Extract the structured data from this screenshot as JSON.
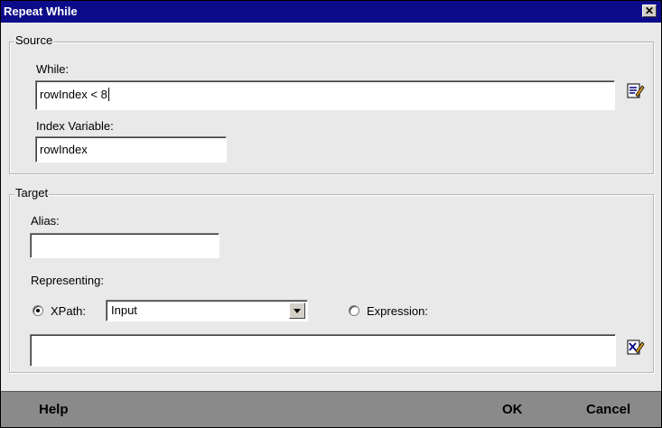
{
  "dialog": {
    "title": "Repeat While",
    "close_glyph": "✕"
  },
  "source": {
    "legend": "Source",
    "while_label": "While:",
    "while_value": "rowIndex < 8",
    "while_edit_icon": "edit-expression-icon",
    "index_label": "Index Variable:",
    "index_value": "rowIndex"
  },
  "target": {
    "legend": "Target",
    "alias_label": "Alias:",
    "alias_value": "",
    "representing_label": "Representing:",
    "xpath_label": "XPath:",
    "xpath_selected": "Input",
    "expression_label": "Expression:",
    "expression_value": "",
    "expression_edit_icon": "edit-xpath-icon"
  },
  "footer": {
    "help": "Help",
    "ok": "OK",
    "cancel": "Cancel"
  },
  "colors": {
    "titlebar": "#0c0c8a",
    "body": "#e9e9e9",
    "footer": "#8a8a8a"
  }
}
